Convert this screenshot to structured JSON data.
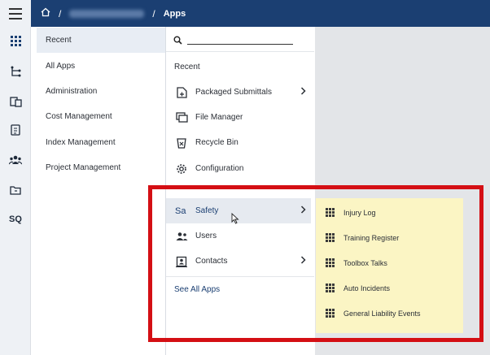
{
  "header": {
    "breadcrumb_sep": "/",
    "current": "Apps",
    "bg_color": "#1b3f72"
  },
  "rail": {
    "icons": [
      "apps-grid-icon",
      "hierarchy-icon",
      "documents-icon",
      "clipboard-icon",
      "team-icon",
      "folder-icon"
    ],
    "sq_label": "SQ"
  },
  "categories": {
    "items": [
      {
        "label": "Recent",
        "active": true
      },
      {
        "label": "All Apps"
      },
      {
        "label": "Administration"
      },
      {
        "label": "Cost Management"
      },
      {
        "label": "Index Management"
      },
      {
        "label": "Project Management"
      }
    ]
  },
  "search": {
    "placeholder": ""
  },
  "recent": {
    "title": "Recent",
    "items": [
      {
        "label": "Packaged Submittals",
        "icon": "package-icon",
        "has_submenu": true
      },
      {
        "label": "File Manager",
        "icon": "file-manager-icon"
      },
      {
        "label": "Recycle Bin",
        "icon": "recycle-bin-icon"
      },
      {
        "label": "Configuration",
        "icon": "gear-icon"
      }
    ]
  },
  "apps": {
    "items": [
      {
        "label": "Safety",
        "icon_text": "Sa",
        "has_submenu": true,
        "hovered": true
      },
      {
        "label": "Users",
        "icon": "users-icon"
      },
      {
        "label": "Contacts",
        "icon": "contacts-icon",
        "has_submenu": true
      }
    ],
    "see_all": "See All Apps"
  },
  "safety_submenu": {
    "items": [
      {
        "label": "Injury Log"
      },
      {
        "label": "Training Register"
      },
      {
        "label": "Toolbox Talks"
      },
      {
        "label": "Auto Incidents"
      },
      {
        "label": "General Liability Events"
      }
    ],
    "bg_color": "#fbf5c4"
  },
  "highlight_color": "#d40f14"
}
